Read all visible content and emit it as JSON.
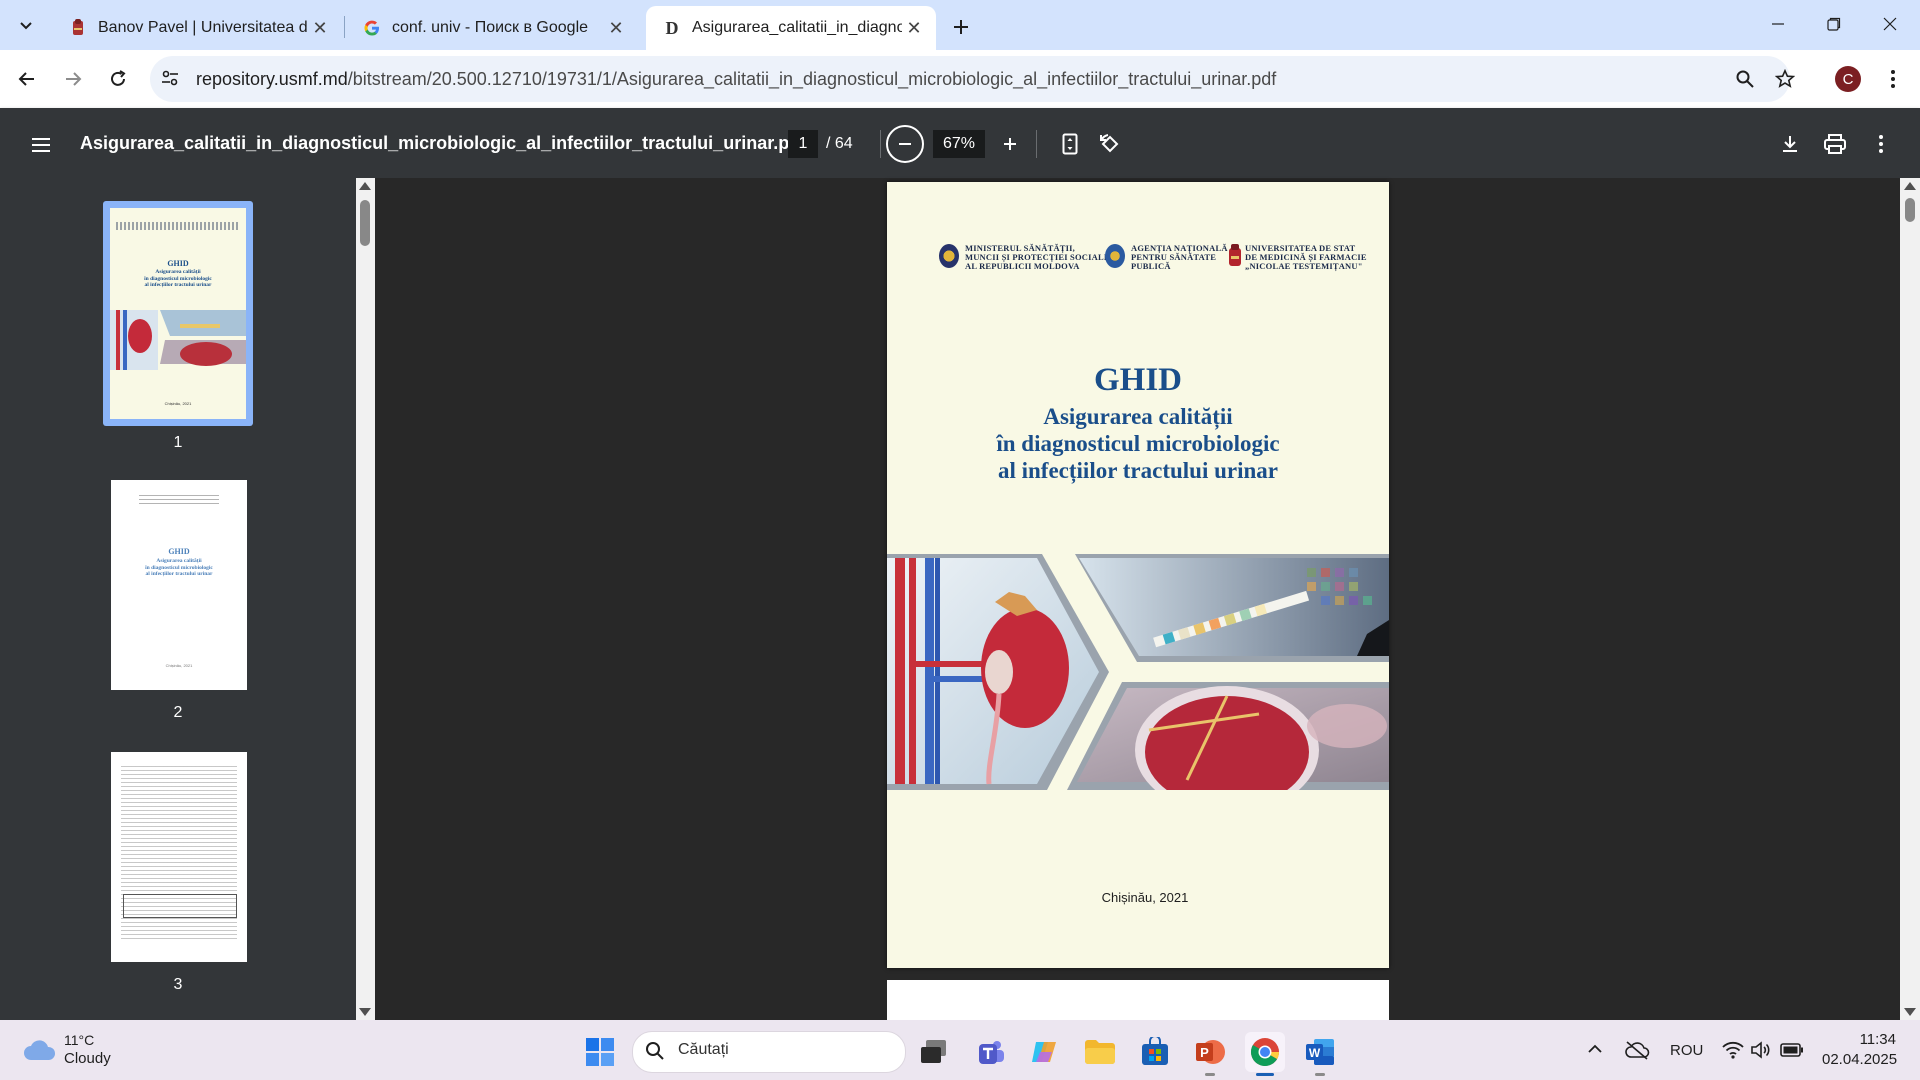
{
  "browser": {
    "tabs": [
      {
        "title": "Banov Pavel | Universitatea de S",
        "active": false,
        "icon": "university-favicon-icon"
      },
      {
        "title": "conf. univ - Поиск в Google",
        "active": false,
        "icon": "google-favicon-icon"
      },
      {
        "title": "Asigurarea_calitatii_in_diagnost",
        "active": true,
        "icon": "dspace-favicon-icon"
      }
    ],
    "url_domain": "repository.usmf.md",
    "url_path": "/bitstream/20.500.12710/19731/1/Asigurarea_calitatii_in_diagnosticul_microbiologic_al_infectiilor_tractului_urinar.pdf",
    "profile_initial": "C"
  },
  "pdf": {
    "filename": "Asigurarea_calitatii_in_diagnosticul_microbiologic_al_infectiilor_tractului_urinar.pdf",
    "current_page": "1",
    "total_pages": "/ 64",
    "zoom": "67%",
    "thumbnails": [
      {
        "label": "1",
        "selected": true
      },
      {
        "label": "2",
        "selected": false
      },
      {
        "label": "3",
        "selected": false
      }
    ],
    "cover": {
      "logo1": [
        "MINISTERUL SĂNĂTĂȚII,",
        "MUNCII ȘI PROTECȚIEI SOCIALE",
        "AL REPUBLICII MOLDOVA"
      ],
      "logo2": [
        "AGENȚIA NAȚIONALĂ",
        "PENTRU SĂNĂTATE",
        "PUBLICĂ"
      ],
      "logo3": [
        "UNIVERSITATEA DE STAT",
        "DE MEDICINĂ ȘI FARMACIE",
        "„NICOLAE TESTEMIȚANU\""
      ],
      "heading": "GHID",
      "title_line1": "Asigurarea calității",
      "title_line2": "în diagnosticul microbiologic",
      "title_line3": "al infecțiilor tractului urinar",
      "place_year": "Chișinău, 2021"
    },
    "thumb2": {
      "heading": "GHID",
      "lines": [
        "Asigurarea calității",
        "în diagnosticul microbiologic",
        "al infecțiilor tractului urinar"
      ],
      "footer": "Chișinău, 2021"
    }
  },
  "taskbar": {
    "weather_temp": "11°C",
    "weather_desc": "Cloudy",
    "search_placeholder": "Căutați",
    "language": "ROU",
    "time": "11:34",
    "date": "02.04.2025"
  },
  "colors": {
    "accent_blue": "#1a4e8a",
    "pdf_toolbar": "#333639",
    "viewer_bg": "#282828",
    "cover_bg": "#f9f9e5",
    "tab_strip": "#d3e3fd"
  }
}
